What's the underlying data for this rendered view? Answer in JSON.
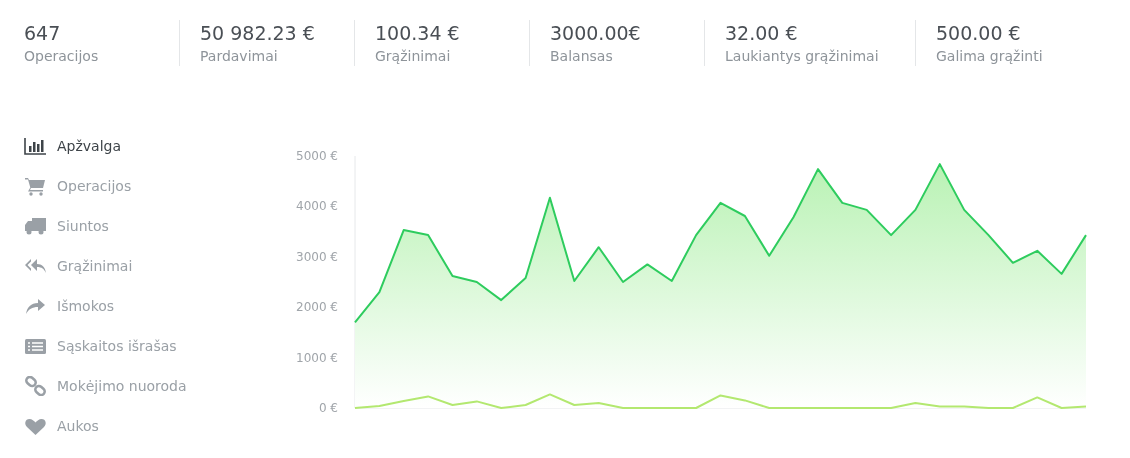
{
  "stats": [
    {
      "value": "647",
      "label": "Operacijos"
    },
    {
      "value": "50 982.23 €",
      "label": "Pardavimai"
    },
    {
      "value": "100.34 €",
      "label": "Grąžinimai"
    },
    {
      "value": "3000.00€",
      "label": "Balansas"
    },
    {
      "value": "32.00 €",
      "label": "Laukiantys grąžinimai"
    },
    {
      "value": "500.00 €",
      "label": "Galima grąžinti"
    }
  ],
  "sidebar": {
    "items": [
      {
        "label": "Apžvalga",
        "selected": true
      },
      {
        "label": "Operacijos",
        "selected": false
      },
      {
        "label": "Siuntos",
        "selected": false
      },
      {
        "label": "Grąžinimai",
        "selected": false
      },
      {
        "label": "Išmokos",
        "selected": false
      },
      {
        "label": "Sąskaitos išrašas",
        "selected": false
      },
      {
        "label": "Mokėjimo nuoroda",
        "selected": false
      },
      {
        "label": "Aukos",
        "selected": false
      }
    ]
  },
  "chart": {
    "chart_data": {
      "type": "area",
      "ylim": [
        0,
        5000
      ],
      "yticks": [
        {
          "value": 0,
          "label": "0 €"
        },
        {
          "value": 1000,
          "label": "1000 €"
        },
        {
          "value": 2000,
          "label": "2000 €"
        },
        {
          "value": 3000,
          "label": "3000 €"
        },
        {
          "value": 4000,
          "label": "4000 €"
        },
        {
          "value": 5000,
          "label": "5000 €"
        }
      ],
      "series": [
        {
          "type": "area",
          "color": "#2ecc5e",
          "values": [
            1700,
            2300,
            3530,
            3430,
            2620,
            2500,
            2140,
            2580,
            4170,
            2520,
            3190,
            2500,
            2850,
            2520,
            3430,
            4070,
            3810,
            3020,
            3790,
            4740,
            4070,
            3930,
            3430,
            3930,
            4840,
            3930,
            3430,
            2880,
            3120,
            2660,
            3430
          ]
        },
        {
          "type": "line",
          "color": "#b3e870",
          "values": [
            0,
            40,
            140,
            230,
            60,
            130,
            0,
            60,
            270,
            60,
            100,
            0,
            0,
            0,
            0,
            250,
            150,
            0,
            0,
            0,
            0,
            0,
            0,
            100,
            30,
            30,
            0,
            0,
            210,
            0,
            30
          ]
        }
      ]
    }
  }
}
